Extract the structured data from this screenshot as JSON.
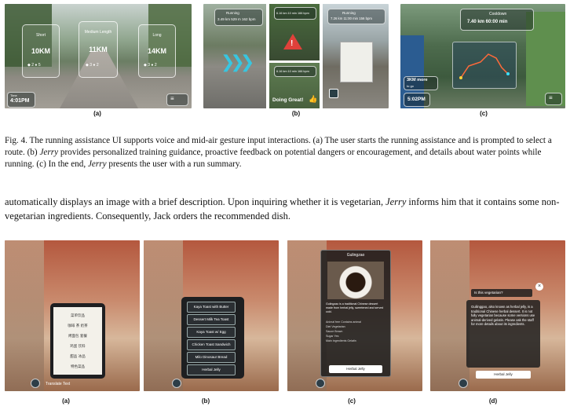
{
  "top_row": {
    "a": {
      "cards": [
        {
          "route": "Short",
          "distance": "10KM",
          "stat1": "2",
          "stat2": "5"
        },
        {
          "route": "Medium Length",
          "distance": "11KM",
          "stat1": "3",
          "stat2": "2"
        },
        {
          "route": "Long",
          "distance": "14KM",
          "stat1": "3",
          "stat2": "2"
        }
      ],
      "time_label": "Time",
      "time": "4:01PM",
      "label": "(a)"
    },
    "b": {
      "running_label": "Running",
      "left_stats": "3.49 km   529 m   162 bpm",
      "mid_stats": "6.16 km   10 min   166 bpm",
      "doing_great": "Doing Great!",
      "right_stats": "7.26 km   11:00 min   156 bpm",
      "label": "(b)"
    },
    "c": {
      "header": "Cooldown",
      "stats": "7.40 km   60:00 min",
      "remaining": "3KM more",
      "remaining_sub": "to go",
      "time": "5:02PM",
      "label": "(c)"
    }
  },
  "caption": {
    "fig": "Fig. 4.",
    "text1": "The running assistance UI supports voice and mid-air gesture input interactions. (a) The user starts the running assistance and is prompted to select a route. (b) ",
    "jerry1": "Jerry",
    "text2": " provides personalized training guidance, proactive feedback on potential dangers or encouragement, and details about water points while running. (c) In the end, ",
    "jerry2": "Jerry",
    "text3": " presents the user with a run summary."
  },
  "body_text": {
    "part1": "automatically displays an image with a brief description. Upon inquiring whether it is vegetarian, ",
    "jerry": "Jerry",
    "part2": " informs him that it contains some non-vegetarian ingredients. Consequently, Jack orders the recommended dish."
  },
  "bottom_row": {
    "a": {
      "menu_lines": [
        "菜单饮品",
        "咖啡 茶 奶茶",
        "烤面包 套餐",
        "鸡蛋 饮料",
        "甜品 冰品",
        "特色菜品"
      ],
      "translate": "Translate Text",
      "label": "(a)"
    },
    "b": {
      "items": [
        "Kaya Toast with Butter",
        "Dessert Milk Tea Toast",
        "Kaya Toast w/ Egg",
        "Chicken Toast Sandwich",
        "Milo Dinosaur Bread",
        "Herbal Jelly"
      ],
      "label": "(b)"
    },
    "c": {
      "title": "Gulingzao",
      "desc": "Gulingzao is a traditional Chinese dessert made from herbal jelly, sweetened and served cold.",
      "rows": [
        [
          "Animal free",
          "Contains animal"
        ],
        [
          "Diet",
          "Vegetarian"
        ],
        [
          "Sauce",
          "Brown"
        ],
        [
          "Sugar",
          "Yes"
        ],
        [
          "Main ingredients",
          "Gelatin"
        ]
      ],
      "button": "Herbal Jelly",
      "label": "(c)"
    },
    "d": {
      "question": "Is this vegetarian?",
      "answer": "Guilinggao, also known as herbal jelly, is a traditional Chinese herbal dessert. It is not fully vegetarian because some versions use animal-derived gelatin. Please ask the staff for more details about its ingredients.",
      "button": "Herbal Jelly",
      "label": "(d)"
    }
  }
}
